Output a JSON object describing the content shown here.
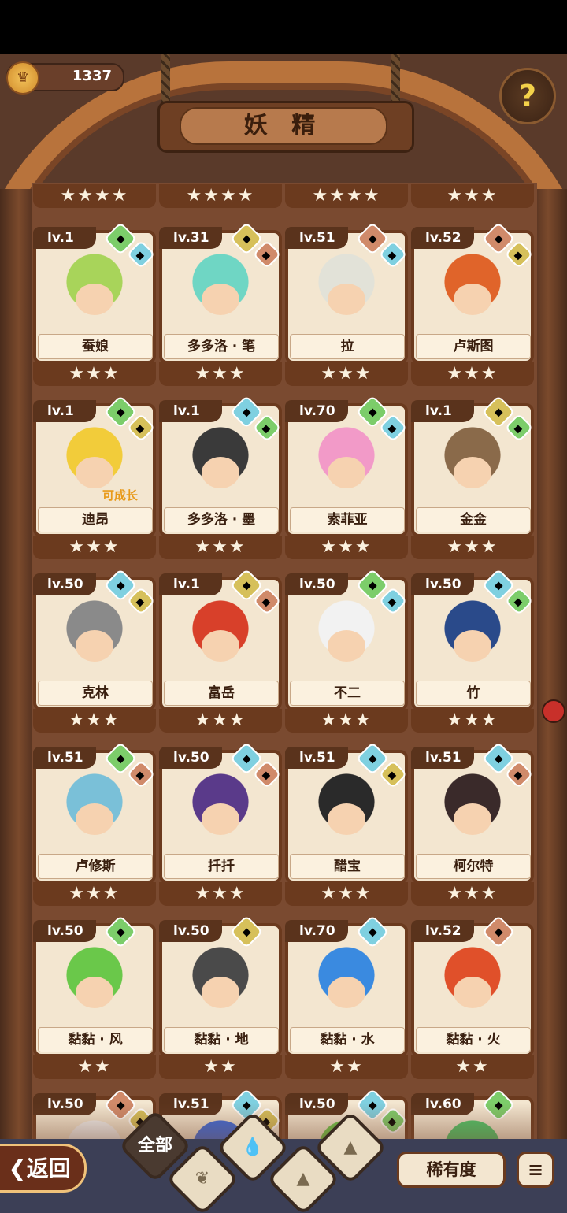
{
  "header": {
    "coins": "1337",
    "title": "妖 精",
    "help_symbol": "?"
  },
  "top_row_stars": [
    "★★★★",
    "★★★★",
    "★★★★",
    "★★★"
  ],
  "cards": [
    {
      "level": "lv.1",
      "name": "蚕娘",
      "stars": "★★★",
      "color": "#a8d45a",
      "e1": "#7ccd6a",
      "e2": "#7fd0e0"
    },
    {
      "level": "lv.31",
      "name": "多多洛 · 笔",
      "stars": "★★★",
      "color": "#6fd6c4",
      "e1": "#d6c05a",
      "e2": "#d08a6a"
    },
    {
      "level": "lv.51",
      "name": "拉",
      "stars": "★★★",
      "color": "#e2e2d8",
      "e1": "#d08a6a",
      "e2": "#7fd0e0"
    },
    {
      "level": "lv.52",
      "name": "卢斯图",
      "stars": "★★★",
      "color": "#e0642a",
      "e1": "#d08a6a",
      "e2": "#d6c05a"
    },
    {
      "level": "lv.1",
      "name": "迪昂",
      "stars": "★★★",
      "color": "#f2cc3a",
      "e1": "#7ccd6a",
      "e2": "#d6c05a",
      "note": "可成长"
    },
    {
      "level": "lv.1",
      "name": "多多洛 · 墨",
      "stars": "★★★",
      "color": "#3a3a3a",
      "e1": "#7fd0e0",
      "e2": "#7ccd6a"
    },
    {
      "level": "lv.70",
      "name": "索菲亚",
      "stars": "★★★",
      "color": "#f29ac8",
      "e1": "#7ccd6a",
      "e2": "#7fd0e0"
    },
    {
      "level": "lv.1",
      "name": "金金",
      "stars": "★★★",
      "color": "#8a6a4a",
      "e1": "#d6c05a",
      "e2": "#7ccd6a"
    },
    {
      "level": "lv.50",
      "name": "克林",
      "stars": "★★★",
      "color": "#8a8a8a",
      "e1": "#7fd0e0",
      "e2": "#d6c05a"
    },
    {
      "level": "lv.1",
      "name": "富岳",
      "stars": "★★★",
      "color": "#d8402a",
      "e1": "#d6c05a",
      "e2": "#d08a6a"
    },
    {
      "level": "lv.50",
      "name": "不二",
      "stars": "★★★",
      "color": "#f2f2f2",
      "e1": "#7ccd6a",
      "e2": "#7fd0e0"
    },
    {
      "level": "lv.50",
      "name": "竹",
      "stars": "★★★",
      "color": "#2a4a8a",
      "e1": "#7fd0e0",
      "e2": "#7ccd6a"
    },
    {
      "level": "lv.51",
      "name": "卢修斯",
      "stars": "★★★",
      "color": "#7ac0d8",
      "e1": "#7ccd6a",
      "e2": "#d08a6a"
    },
    {
      "level": "lv.50",
      "name": "扦扦",
      "stars": "★★★",
      "color": "#5a3a8a",
      "e1": "#7fd0e0",
      "e2": "#d08a6a"
    },
    {
      "level": "lv.51",
      "name": "醋宝",
      "stars": "★★★",
      "color": "#2a2a2a",
      "e1": "#7fd0e0",
      "e2": "#d6c05a"
    },
    {
      "level": "lv.51",
      "name": "柯尔特",
      "stars": "★★★",
      "color": "#3a2a2a",
      "e1": "#7fd0e0",
      "e2": "#d08a6a"
    },
    {
      "level": "lv.50",
      "name": "黏黏 · 风",
      "stars": "★★",
      "color": "#6ac84a",
      "e1": "#7ccd6a",
      "e2": ""
    },
    {
      "level": "lv.50",
      "name": "黏黏 · 地",
      "stars": "★★",
      "color": "#4a4a4a",
      "e1": "#d6c05a",
      "e2": ""
    },
    {
      "level": "lv.70",
      "name": "黏黏 · 水",
      "stars": "★★",
      "color": "#3a8ae0",
      "e1": "#7fd0e0",
      "e2": ""
    },
    {
      "level": "lv.52",
      "name": "黏黏 · 火",
      "stars": "★★",
      "color": "#e0502a",
      "e1": "#d08a6a",
      "e2": ""
    },
    {
      "level": "lv.50",
      "name": "",
      "stars": "",
      "color": "#f2f2f2",
      "e1": "#d08a6a",
      "e2": "#d6c05a"
    },
    {
      "level": "lv.51",
      "name": "",
      "stars": "",
      "color": "#3a6ae0",
      "e1": "#7fd0e0",
      "e2": "#d6c05a"
    },
    {
      "level": "lv.50",
      "name": "",
      "stars": "",
      "color": "#6ac84a",
      "e1": "#7fd0e0",
      "e2": "#7ccd6a"
    },
    {
      "level": "lv.60",
      "name": "",
      "stars": "",
      "color": "#4ac86a",
      "e1": "#7ccd6a",
      "e2": ""
    }
  ],
  "bottom": {
    "back_label": "返回",
    "back_arrow": "❮",
    "filter_all": "全部",
    "filter_icons": [
      "sprout-icon",
      "water-icon",
      "earth-icon",
      "fire-icon"
    ],
    "rarity_label": "稀有度",
    "sort_icon": "≡"
  }
}
